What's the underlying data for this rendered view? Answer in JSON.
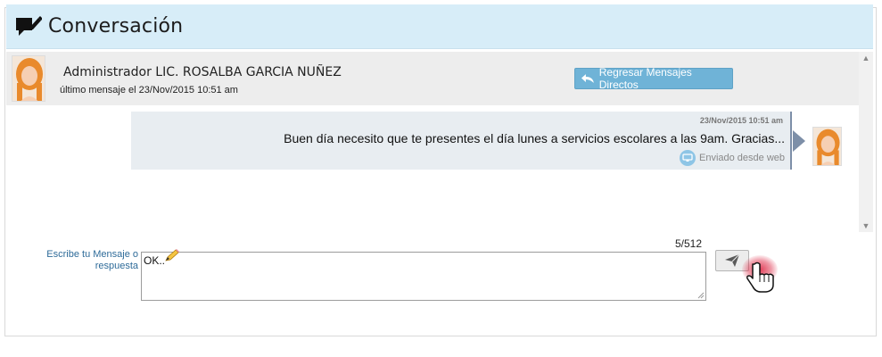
{
  "window": {
    "title": "Conversación",
    "title_icon": "chat-edit-icon"
  },
  "conversation": {
    "contact_name": "Administrador LIC. ROSALBA GARCIA NUÑEZ",
    "last_message": "último mensaje el 23/Nov/2015 10:51 am",
    "back_button_label": "Regresar Mensajes Directos",
    "back_button_icon": "reply-arrow-icon"
  },
  "messages": [
    {
      "date": "23/Nov/2015 10:51 am",
      "text": "Buen día necesito que te presentes el día lunes a servicios escolares a las 9am. Gracias...",
      "sent_via": "Enviado desde web",
      "sent_via_icon": "monitor-icon"
    }
  ],
  "reply": {
    "label": "Escribe tu Mensaje o respuesta",
    "value": "OK..",
    "char_count": "5/512",
    "send_icon": "paper-plane-icon"
  },
  "colors": {
    "title_bar": "#d7edf8",
    "header_strip": "#ededed",
    "bubble": "#e8edf1",
    "bubble_border": "#7d8fa8",
    "accent_button": "#6fb3d7",
    "label_blue": "#2e6b99"
  }
}
